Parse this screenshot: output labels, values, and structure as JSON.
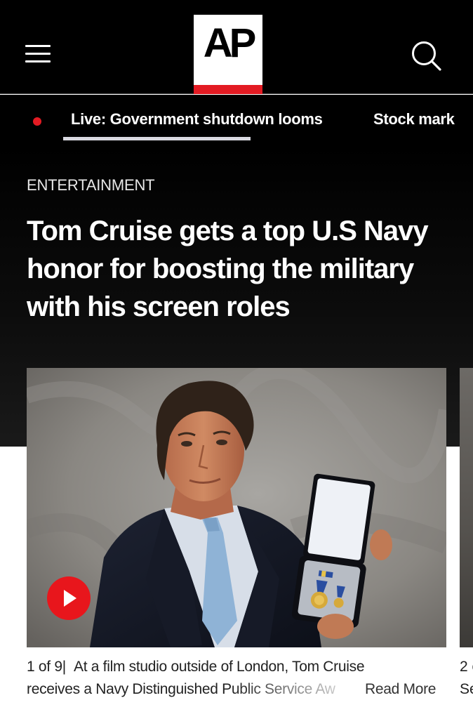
{
  "header": {
    "logo_text": "AP",
    "menu_icon": "hamburger-menu-icon",
    "search_icon": "search-icon",
    "logo_accent_color": "#e31b23"
  },
  "trending": {
    "live_indicator_color": "#e31b23",
    "items": [
      {
        "label": "Live: Government shutdown looms",
        "active": true
      },
      {
        "label": "Stock mark"
      }
    ]
  },
  "article": {
    "section": "ENTERTAINMENT",
    "headline": "Tom Cruise gets a top U.S Navy honor for boosting the military with his screen roles"
  },
  "gallery": {
    "counter": "1 of 9",
    "caption_line1": "At a film studio outside of London, Tom Cruise",
    "caption_line2": "receives a Navy Distinguished Public Service Aw",
    "read_more": "Read More",
    "next_caption_line1": "2 o",
    "next_caption_line2": "Se",
    "play_icon": "play-icon",
    "play_color": "#e8161c"
  }
}
